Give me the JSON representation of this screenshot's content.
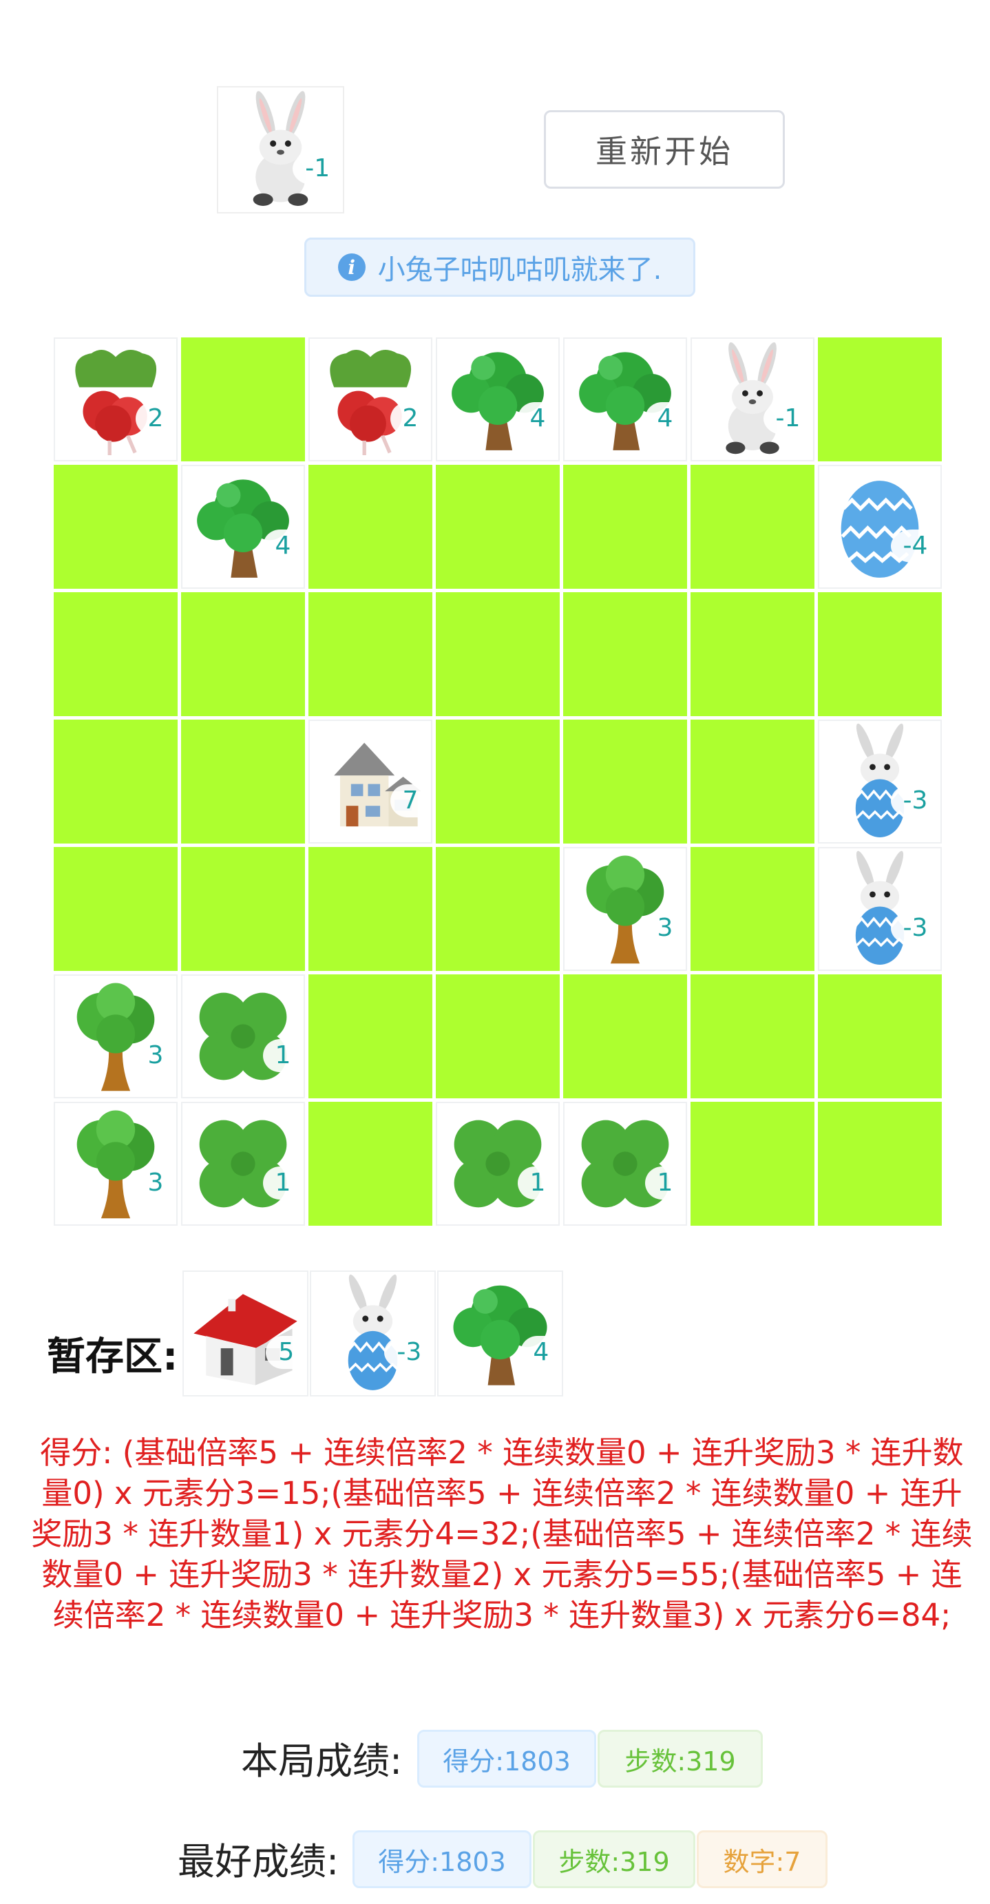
{
  "current_piece": {
    "icon": "bunny-icon",
    "value": "-1"
  },
  "restart_label": "重新开始",
  "info_message": "小兔子咕叽咕叽就来了.",
  "board": [
    [
      {
        "icon": "radish-icon",
        "value": "2"
      },
      {
        "icon": null
      },
      {
        "icon": "radish-icon",
        "value": "2"
      },
      {
        "icon": "bush-tree-icon",
        "value": "4"
      },
      {
        "icon": "bush-tree-icon",
        "value": "4"
      },
      {
        "icon": "bunny-icon",
        "value": "-1"
      },
      {
        "icon": null
      }
    ],
    [
      {
        "icon": null
      },
      {
        "icon": "bush-tree-icon",
        "value": "4"
      },
      {
        "icon": null
      },
      {
        "icon": null
      },
      {
        "icon": null
      },
      {
        "icon": null
      },
      {
        "icon": "easter-egg-icon",
        "value": "-4"
      }
    ],
    [
      {
        "icon": null
      },
      {
        "icon": null
      },
      {
        "icon": null
      },
      {
        "icon": null
      },
      {
        "icon": null
      },
      {
        "icon": null
      },
      {
        "icon": null
      }
    ],
    [
      {
        "icon": null
      },
      {
        "icon": null
      },
      {
        "icon": "mansion-icon",
        "value": "7"
      },
      {
        "icon": null
      },
      {
        "icon": null
      },
      {
        "icon": null
      },
      {
        "icon": "egg-bunny-icon",
        "value": "-3"
      }
    ],
    [
      {
        "icon": null
      },
      {
        "icon": null
      },
      {
        "icon": null
      },
      {
        "icon": null
      },
      {
        "icon": "tree-icon",
        "value": "3"
      },
      {
        "icon": null
      },
      {
        "icon": "egg-bunny-icon",
        "value": "-3"
      }
    ],
    [
      {
        "icon": "tree-icon",
        "value": "3"
      },
      {
        "icon": "clover-icon",
        "value": "1"
      },
      {
        "icon": null
      },
      {
        "icon": null
      },
      {
        "icon": null
      },
      {
        "icon": null
      },
      {
        "icon": null
      }
    ],
    [
      {
        "icon": "tree-icon",
        "value": "3"
      },
      {
        "icon": "clover-icon",
        "value": "1"
      },
      {
        "icon": null
      },
      {
        "icon": "clover-icon",
        "value": "1"
      },
      {
        "icon": "clover-icon",
        "value": "1"
      },
      {
        "icon": null
      },
      {
        "icon": null
      }
    ]
  ],
  "stash": {
    "label": "暂存区:",
    "items": [
      {
        "icon": "cottage-icon",
        "value": "5"
      },
      {
        "icon": "egg-bunny-icon",
        "value": "-3"
      },
      {
        "icon": "bush-tree-icon",
        "value": "4"
      }
    ]
  },
  "score_formula": "得分: (基础倍率5 + 连续倍率2 * 连续数量0 + 连升奖励3 * 连升数量0) x 元素分3=15;(基础倍率5 + 连续倍率2 * 连续数量0 + 连升奖励3 * 连升数量1) x 元素分4=32;(基础倍率5 + 连续倍率2 * 连续数量0 + 连升奖励3 * 连升数量2) x 元素分5=55;(基础倍率5 + 连续倍率2 * 连续数量0 + 连升奖励3 * 连升数量3) x 元素分6=84;",
  "current_score": {
    "label": "本局成绩:",
    "score": "得分:1803",
    "steps": "步数:319"
  },
  "best_score": {
    "label": "最好成绩:",
    "score": "得分:1803",
    "steps": "步数:319",
    "digit": "数字:7"
  },
  "colors": {
    "grass": "#adff2f",
    "score_red": "#e02020",
    "number_teal": "#1aa0a0"
  }
}
